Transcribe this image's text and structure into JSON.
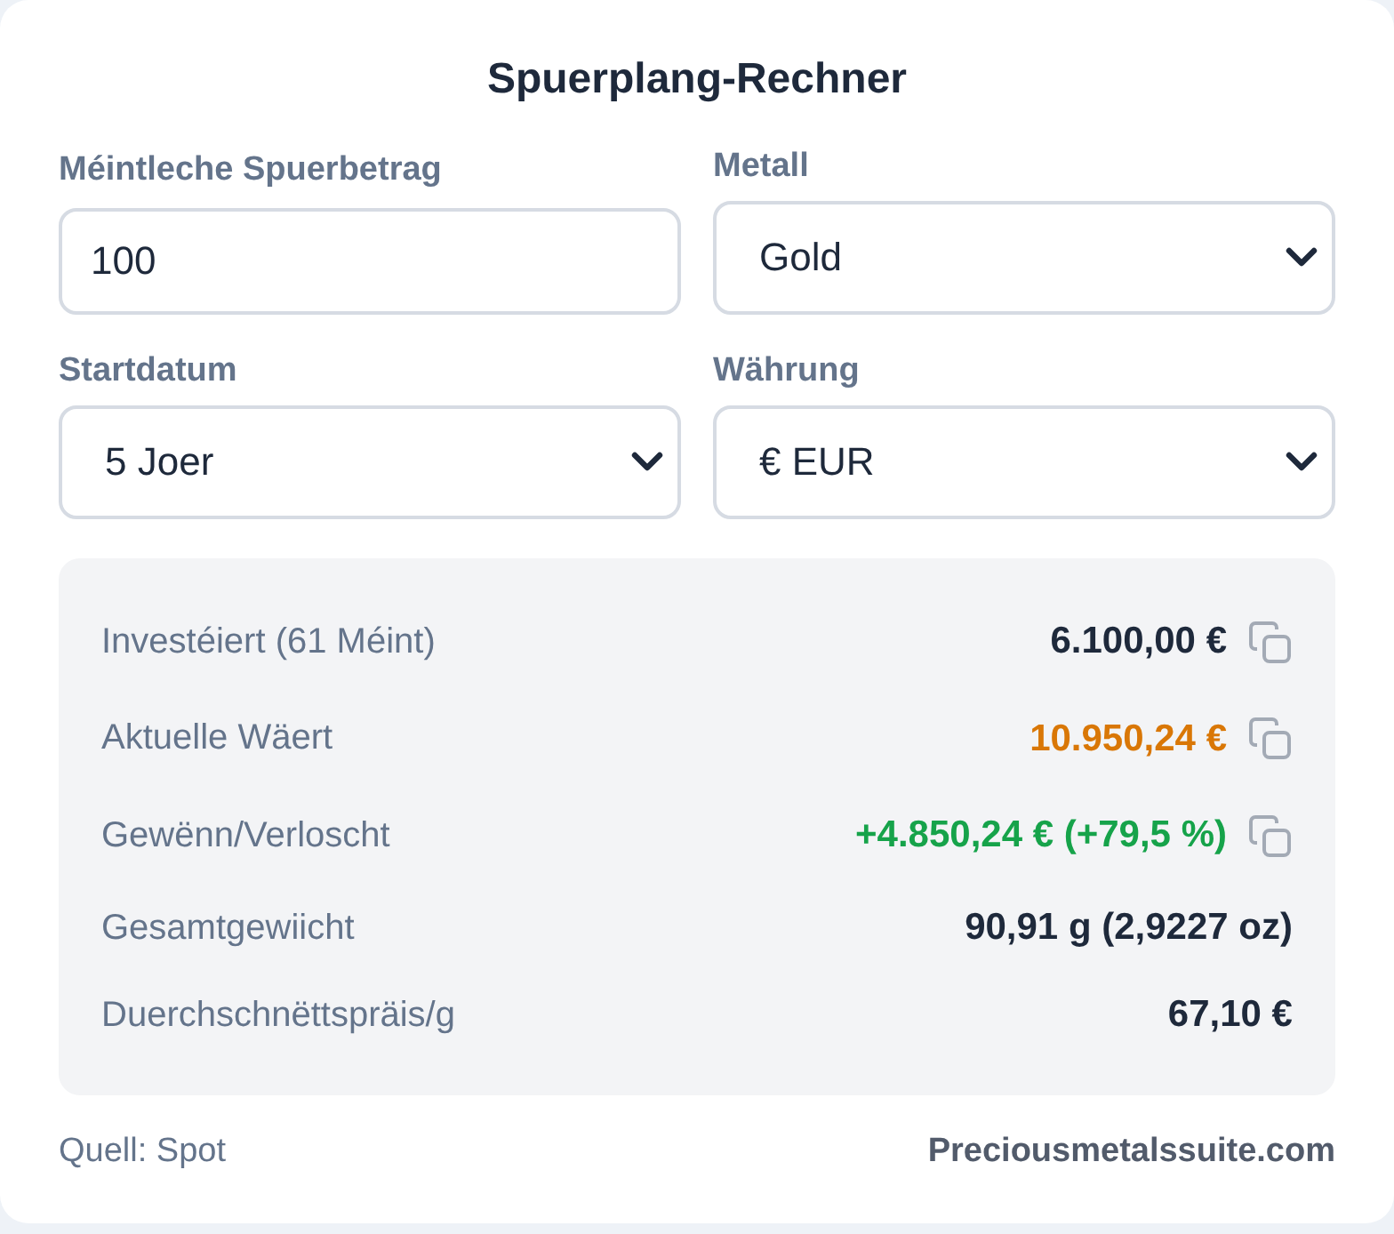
{
  "title": "Spuerplang-Rechner",
  "fields": [
    {
      "kind": "input",
      "label": "Méintleche Spuerbetrag",
      "value": "100"
    },
    {
      "kind": "select",
      "label": "Metall",
      "value": "Gold"
    },
    {
      "kind": "select",
      "label": "Startdatum",
      "value": "5 Joer"
    },
    {
      "kind": "select",
      "label": "Währung",
      "value": "€ EUR"
    }
  ],
  "results": [
    {
      "label": "Investéiert (61 Méint)",
      "value": "6.100,00 €",
      "color": "#1e293b",
      "copy": true
    },
    {
      "label": "Aktuelle Wäert",
      "value": "10.950,24 €",
      "color": "#d97706",
      "copy": true
    },
    {
      "label": "Gewënn/Verloscht",
      "value": "+4.850,24 € (+79,5 %)",
      "color": "#16a34a",
      "copy": true
    },
    {
      "label": "Gesamtgewiicht",
      "value": "90,91 g (2,9227 oz)",
      "color": "#1e293b",
      "copy": false
    },
    {
      "label": "Duerchschnëttspräis/g",
      "value": "67,10 €",
      "color": "#1e293b",
      "copy": false
    }
  ],
  "footer": {
    "source": "Quell: Spot",
    "site": "Preciousmetalssuite.com"
  }
}
